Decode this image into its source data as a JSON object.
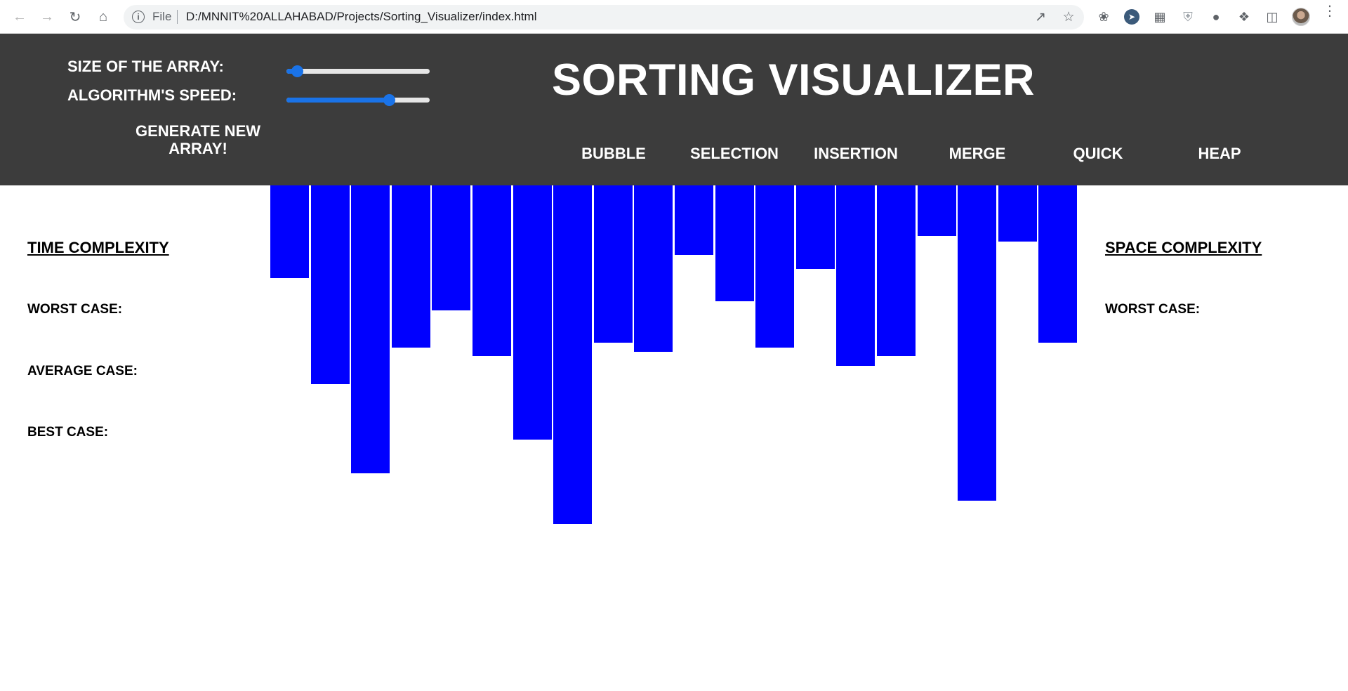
{
  "browser": {
    "file_label": "File",
    "url": "D:/MNNIT%20ALLAHABAD/Projects/Sorting_Visualizer/index.html"
  },
  "controls": {
    "size_label": "SIZE OF THE ARRAY:",
    "speed_label": "ALGORITHM'S SPEED:",
    "generate_label": "GENERATE NEW ARRAY!",
    "size_slider_fraction": 0.04,
    "speed_slider_fraction": 0.74,
    "accent_color": "#1a73e8"
  },
  "title": "SORTING VISUALIZER",
  "algorithms": [
    "BUBBLE",
    "SELECTION",
    "INSERTION",
    "MERGE",
    "QUICK",
    "HEAP"
  ],
  "time_complexity": {
    "title": "TIME COMPLEXITY",
    "worst": "WORST CASE:",
    "average": "AVERAGE CASE:",
    "best": "BEST CASE:"
  },
  "space_complexity": {
    "title": "SPACE COMPLEXITY",
    "worst": "WORST CASE:"
  },
  "array": {
    "bar_color": "#0000ff",
    "header_color": "#3c3c3c",
    "values": [
      132,
      283,
      410,
      231,
      178,
      243,
      362,
      482,
      224,
      237,
      99,
      165,
      231,
      119,
      257,
      243,
      72,
      449,
      80,
      224
    ]
  }
}
